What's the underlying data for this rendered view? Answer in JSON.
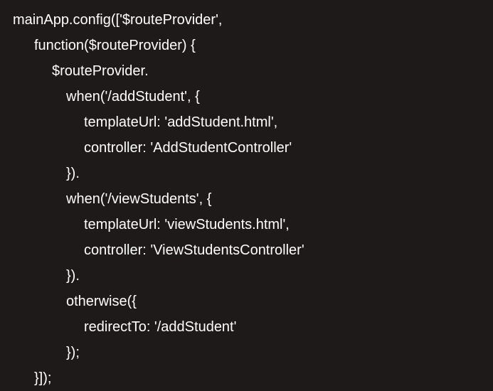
{
  "code": {
    "line1": "mainApp.config(['$routeProvider',",
    "line2": "function($routeProvider) {",
    "line3": "$routeProvider.",
    "line4": "when('/addStudent', {",
    "line5": "templateUrl: 'addStudent.html',",
    "line6": "controller: 'AddStudentController'",
    "line7": "}).",
    "line8": "when('/viewStudents', {",
    "line9": "templateUrl: 'viewStudents.html',",
    "line10": "controller: 'ViewStudentsController'",
    "line11": "}).",
    "line12": "otherwise({",
    "line13": "redirectTo: '/addStudent'",
    "line14": "});",
    "line15": "}]);"
  }
}
